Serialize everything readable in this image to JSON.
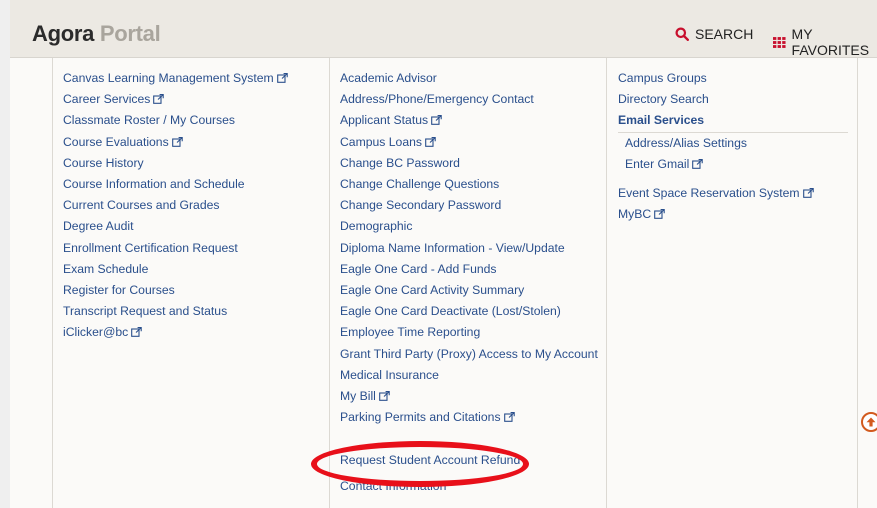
{
  "header": {
    "brand_main": "Agora",
    "brand_sub": "Portal",
    "search_label": "SEARCH",
    "favorites_label": "MY FAVORITES"
  },
  "colors": {
    "link": "#2a4f8c",
    "accent_red": "#c8102e",
    "highlight_ellipse": "#e8101a"
  },
  "col1": {
    "items": [
      {
        "label": "Canvas Learning Management System",
        "external": true
      },
      {
        "label": "Career Services",
        "external": true
      },
      {
        "label": "Classmate Roster / My Courses",
        "external": false
      },
      {
        "label": "Course Evaluations",
        "external": true
      },
      {
        "label": "Course History",
        "external": false
      },
      {
        "label": "Course Information and Schedule",
        "external": false
      },
      {
        "label": "Current Courses and Grades",
        "external": false
      },
      {
        "label": "Degree Audit",
        "external": false
      },
      {
        "label": "Enrollment Certification Request",
        "external": false
      },
      {
        "label": "Exam Schedule",
        "external": false
      },
      {
        "label": "Register for Courses",
        "external": false
      },
      {
        "label": "Transcript Request and Status",
        "external": false
      },
      {
        "label": "iClicker@bc",
        "external": true
      }
    ]
  },
  "col2": {
    "items": [
      {
        "label": "Academic Advisor",
        "external": false
      },
      {
        "label": "Address/Phone/Emergency Contact",
        "external": false
      },
      {
        "label": "Applicant Status",
        "external": true
      },
      {
        "label": "Campus Loans",
        "external": true
      },
      {
        "label": "Change BC Password",
        "external": false
      },
      {
        "label": "Change Challenge Questions",
        "external": false
      },
      {
        "label": "Change Secondary Password",
        "external": false
      },
      {
        "label": "Demographic",
        "external": false
      },
      {
        "label": "Diploma Name Information - View/Update",
        "external": false
      },
      {
        "label": "Eagle One Card - Add Funds",
        "external": false
      },
      {
        "label": "Eagle One Card Activity Summary",
        "external": false
      },
      {
        "label": "Eagle One Card Deactivate (Lost/Stolen)",
        "external": false
      },
      {
        "label": "Employee Time Reporting",
        "external": false
      },
      {
        "label": "Grant Third Party (Proxy) Access to My Account",
        "external": false
      },
      {
        "label": "Medical Insurance",
        "external": false
      },
      {
        "label": "My Bill",
        "external": true
      },
      {
        "label": "Parking Permits and Citations",
        "external": true
      },
      {
        "label": "",
        "external": false
      },
      {
        "label": "Request Student Account Refund",
        "external": false
      },
      {
        "label": "Contact Information",
        "external": false
      }
    ]
  },
  "col3": {
    "campus_groups": "Campus Groups",
    "directory_search": "Directory Search",
    "email_services": "Email Services",
    "address_alias": "Address/Alias Settings",
    "enter_gmail": "Enter Gmail",
    "event_space": "Event Space Reservation System",
    "mybc": "MyBC"
  }
}
